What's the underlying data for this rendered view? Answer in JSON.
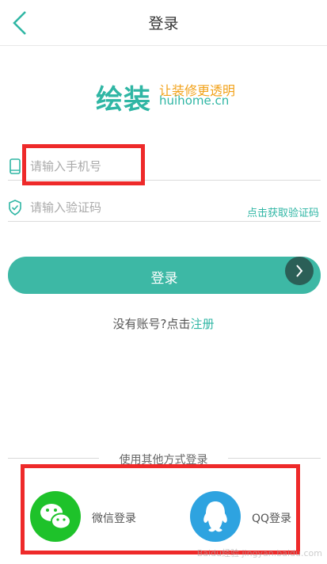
{
  "nav": {
    "title": "登录"
  },
  "logo": {
    "cn": "绘装",
    "slogan": "让装修更透明",
    "domain": "huihome.cn"
  },
  "phone": {
    "placeholder": "请输入手机号"
  },
  "code": {
    "placeholder": "请输入验证码",
    "get_code": "点击获取验证码"
  },
  "login_button": {
    "label": "登录"
  },
  "register": {
    "text": "没有账号?点击",
    "link": "注册"
  },
  "other": {
    "label": "使用其他方式登录"
  },
  "social": [
    {
      "label": "微信登录",
      "color": "#1ec22a"
    },
    {
      "label": "QQ登录",
      "color": "#2ea3e0"
    }
  ],
  "colors": {
    "accent": "#3db8a5",
    "highlight": "#ee2a2a"
  },
  "watermark": "Baidu经验 jingyan.baidu.com"
}
